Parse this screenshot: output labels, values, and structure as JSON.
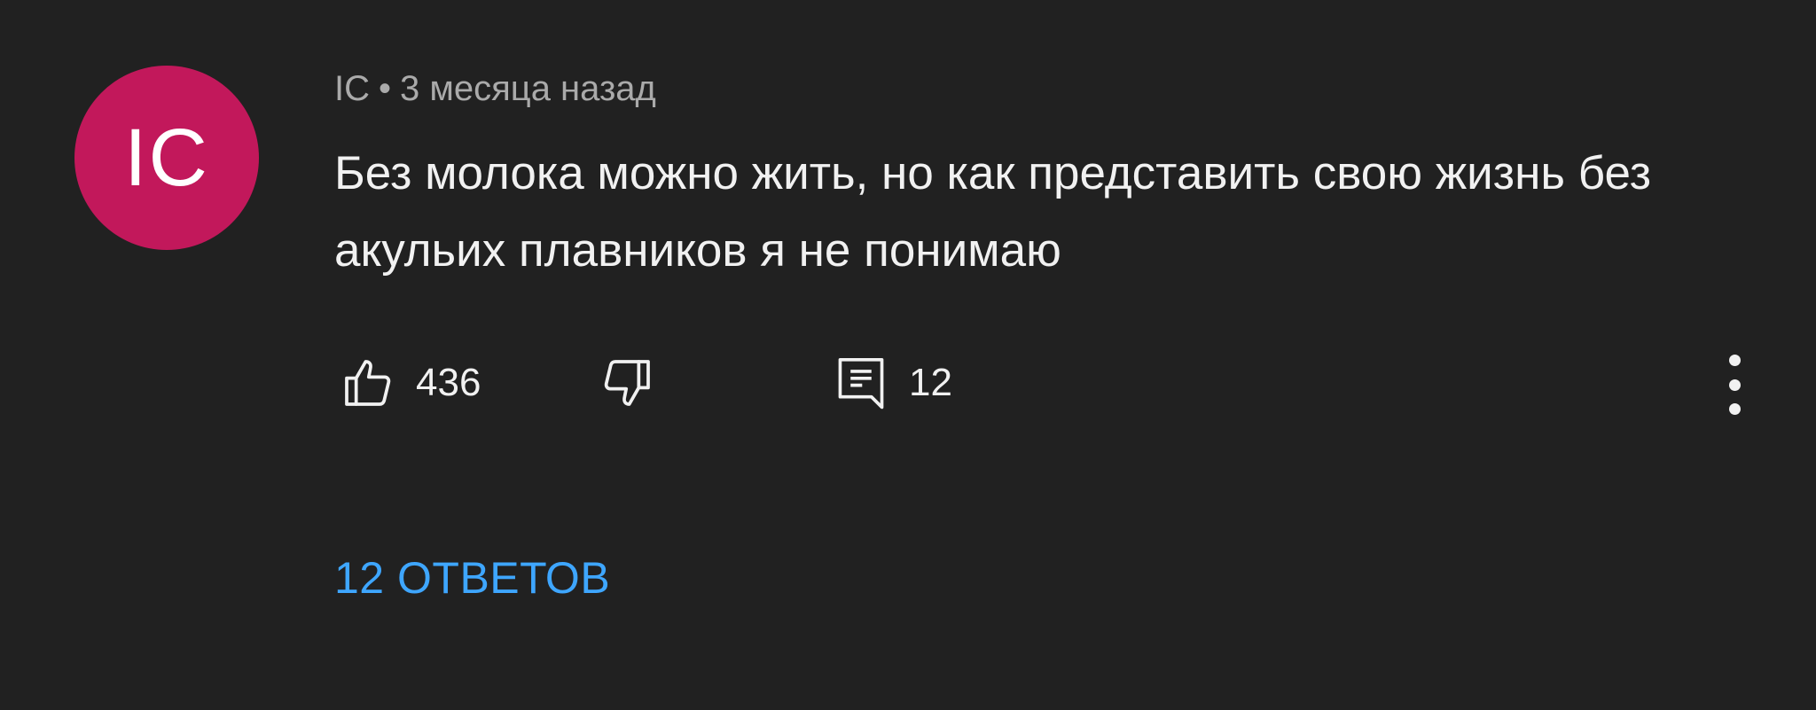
{
  "colors": {
    "background": "#212121",
    "avatar_bg": "#c2185b",
    "meta_text": "#aaaaaa",
    "primary_text": "#f1f1f1",
    "link_blue": "#3ea6ff"
  },
  "comment": {
    "avatar_initials": "IC",
    "author": "IC",
    "separator": "•",
    "time": "3 месяца назад",
    "text": "Без молока можно жить, но как представить свою жизнь без акульих плавников я не понимаю"
  },
  "actions": {
    "like_icon": "thumbs-up-icon",
    "like_count": "436",
    "dislike_icon": "thumbs-down-icon",
    "reply_icon": "comment-icon",
    "reply_count": "12",
    "more_icon": "more-vertical-icon"
  },
  "replies_link": "12 ОТВЕТОВ"
}
